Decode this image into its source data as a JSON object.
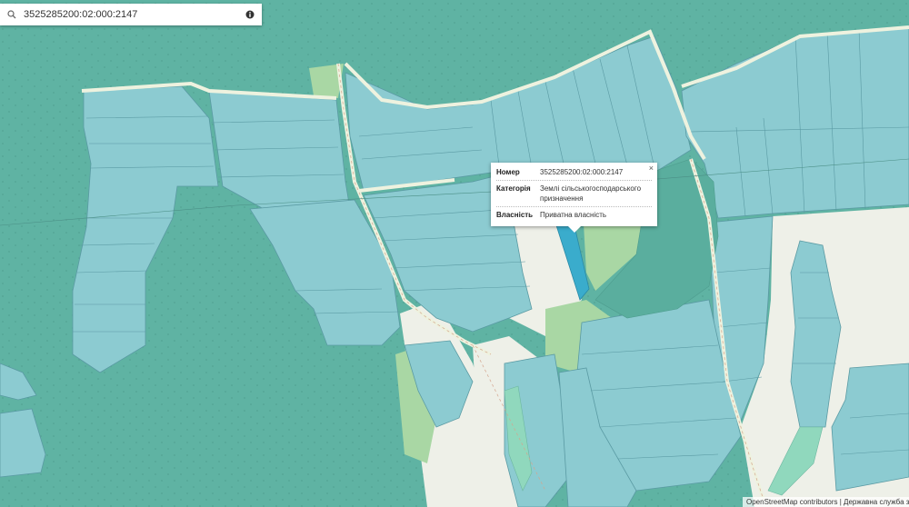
{
  "search": {
    "value": "3525285200:02:000:2147",
    "search_icon": "search-icon",
    "info_icon": "info-icon"
  },
  "popup": {
    "close_label": "×",
    "rows": [
      {
        "key": "Номер",
        "value": "3525285200:02:000:2147"
      },
      {
        "key": "Категорія",
        "value": "Землі сільськогосподарського призначення"
      },
      {
        "key": "Власність",
        "value": "Приватна власність"
      }
    ]
  },
  "attribution": "OpenStreetMap contributors | Державна служба з",
  "colors": {
    "forest": "#5fb3a3",
    "parcel": "#8ccbd1",
    "parcel_border": "#5a9aa3",
    "meadow": "#a9d7a4",
    "road_bg": "#eef0e8",
    "selected": "#3aaccc"
  }
}
